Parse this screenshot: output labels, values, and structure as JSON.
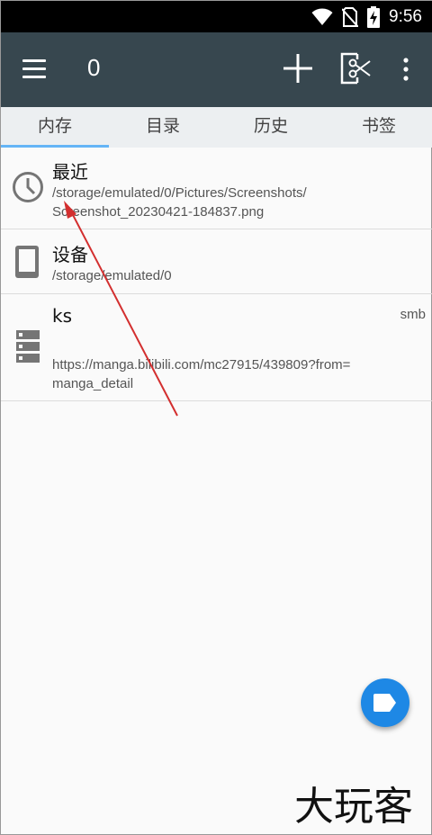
{
  "status_bar": {
    "time": "9:56",
    "icons": [
      "wifi-icon",
      "no-sim-icon",
      "battery-charging-icon"
    ]
  },
  "app_bar": {
    "title": "0",
    "icons": [
      "menu-icon",
      "add-icon",
      "cut-icon",
      "more-vert-icon"
    ]
  },
  "tabs": [
    {
      "label": "内存",
      "active": true
    },
    {
      "label": "目录",
      "active": false
    },
    {
      "label": "历史",
      "active": false
    },
    {
      "label": "书签",
      "active": false
    }
  ],
  "items": [
    {
      "name": "最近",
      "path_lines": [
        "/storage/emulated/0/Pictures/Screenshots/",
        "Screenshot_20230421-184837.png"
      ],
      "icon": "clock-icon"
    },
    {
      "name": "设备",
      "path_lines": [
        "/storage/emulated/0"
      ],
      "icon": "phone-icon"
    },
    {
      "name": "ks",
      "type": "smb",
      "path_lines": [
        "https://manga.bilibili.com/mc27915/439809?from=",
        "manga_detail"
      ],
      "icon": "server-icon"
    }
  ],
  "fab": {
    "icon": "label-icon"
  },
  "watermark": {
    "text": "大玩客"
  },
  "colors": {
    "app_bar": "#37474f",
    "tab_bar": "#eceff1",
    "tab_indicator": "#64b5f6",
    "fab": "#1e88e5",
    "annotation_arrow": "#d32f2f"
  }
}
